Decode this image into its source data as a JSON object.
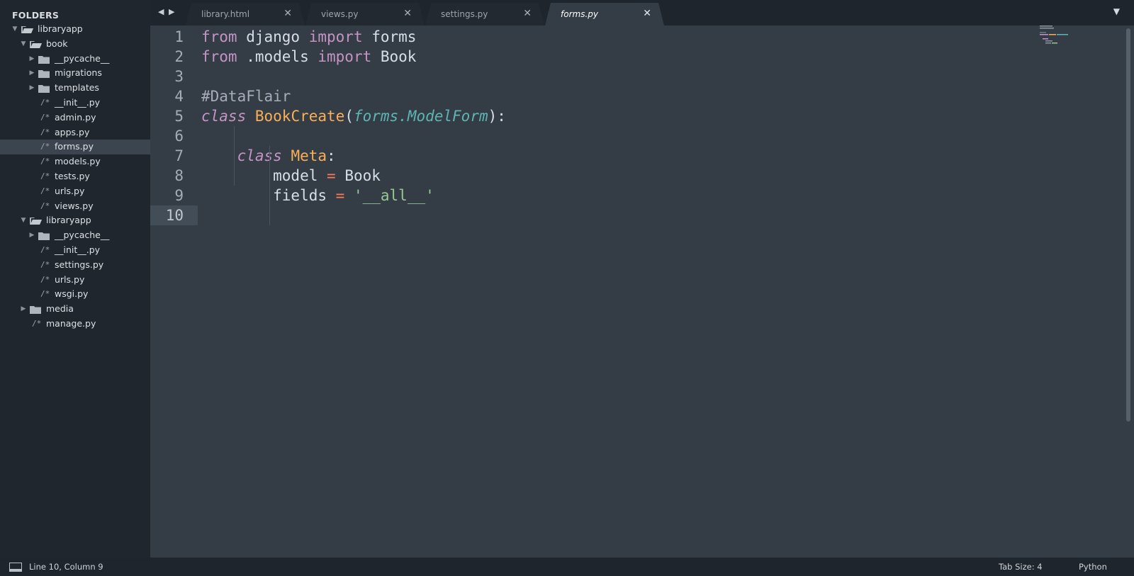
{
  "sidebar": {
    "title": "FOLDERS",
    "items": [
      {
        "label": "libraryapp",
        "type": "folder-open",
        "depth": 0
      },
      {
        "label": "book",
        "type": "folder-open",
        "depth": 1
      },
      {
        "label": "__pycache__",
        "type": "folder-closed",
        "depth": 2
      },
      {
        "label": "migrations",
        "type": "folder-closed",
        "depth": 2
      },
      {
        "label": "templates",
        "type": "folder-closed",
        "depth": 2
      },
      {
        "label": "__init__.py",
        "type": "file",
        "depth": 2
      },
      {
        "label": "admin.py",
        "type": "file",
        "depth": 2
      },
      {
        "label": "apps.py",
        "type": "file",
        "depth": 2
      },
      {
        "label": "forms.py",
        "type": "file",
        "depth": 2,
        "selected": true
      },
      {
        "label": "models.py",
        "type": "file",
        "depth": 2
      },
      {
        "label": "tests.py",
        "type": "file",
        "depth": 2
      },
      {
        "label": "urls.py",
        "type": "file",
        "depth": 2
      },
      {
        "label": "views.py",
        "type": "file",
        "depth": 2
      },
      {
        "label": "libraryapp",
        "type": "folder-open",
        "depth": 1
      },
      {
        "label": "__pycache__",
        "type": "folder-closed",
        "depth": 2
      },
      {
        "label": "__init__.py",
        "type": "file",
        "depth": 2
      },
      {
        "label": "settings.py",
        "type": "file",
        "depth": 2
      },
      {
        "label": "urls.py",
        "type": "file",
        "depth": 2
      },
      {
        "label": "wsgi.py",
        "type": "file",
        "depth": 2
      },
      {
        "label": "media",
        "type": "folder-closed",
        "depth": 1
      },
      {
        "label": "manage.py",
        "type": "file",
        "depth": 1
      }
    ],
    "file_icon_glyph": "/*"
  },
  "tabs": [
    {
      "label": "library.html",
      "active": false
    },
    {
      "label": "views.py",
      "active": false
    },
    {
      "label": "settings.py",
      "active": false
    },
    {
      "label": "forms.py",
      "active": true
    }
  ],
  "tab_close_glyph": "✕",
  "tab_nav": {
    "prev": "◀",
    "next": "▶"
  },
  "tab_menu_glyph": "▼",
  "editor": {
    "line_numbers": [
      "1",
      "2",
      "3",
      "4",
      "5",
      "6",
      "7",
      "8",
      "9",
      "10"
    ],
    "current_line": 10,
    "lines": [
      [
        {
          "t": "from",
          "c": "kw"
        },
        {
          "t": " django ",
          "c": "punc"
        },
        {
          "t": "import",
          "c": "kw"
        },
        {
          "t": " forms",
          "c": "punc"
        }
      ],
      [
        {
          "t": "from",
          "c": "kw"
        },
        {
          "t": " .models ",
          "c": "punc"
        },
        {
          "t": "import",
          "c": "kw"
        },
        {
          "t": " Book",
          "c": "punc"
        }
      ],
      [],
      [
        {
          "t": "#DataFlair",
          "c": "comment"
        }
      ],
      [
        {
          "t": "class",
          "c": "cls-kw"
        },
        {
          "t": " ",
          "c": "punc"
        },
        {
          "t": "BookCreate",
          "c": "cls-name"
        },
        {
          "t": "(",
          "c": "punc"
        },
        {
          "t": "forms.ModelForm",
          "c": "base"
        },
        {
          "t": "):",
          "c": "punc"
        }
      ],
      [],
      [
        {
          "t": "    ",
          "c": "punc"
        },
        {
          "t": "class",
          "c": "cls-kw"
        },
        {
          "t": " ",
          "c": "punc"
        },
        {
          "t": "Meta",
          "c": "cls-name"
        },
        {
          "t": ":",
          "c": "punc"
        }
      ],
      [
        {
          "t": "        model ",
          "c": "punc"
        },
        {
          "t": "=",
          "c": "op"
        },
        {
          "t": " Book",
          "c": "punc"
        }
      ],
      [
        {
          "t": "        fields ",
          "c": "punc"
        },
        {
          "t": "=",
          "c": "op"
        },
        {
          "t": " ",
          "c": "punc"
        },
        {
          "t": "'__all__'",
          "c": "str"
        }
      ],
      []
    ]
  },
  "status": {
    "position": "Line 10, Column 9",
    "tab_size": "Tab Size: 4",
    "syntax": "Python"
  },
  "colors": {
    "sidebar_bg": "#1f262d",
    "editor_bg": "#343d46",
    "selected_row": "#3c454f",
    "keyword": "#c594c5",
    "class_name": "#f9ae58",
    "string": "#99c794",
    "operator": "#f97b58",
    "base_class": "#5fb4b4"
  }
}
